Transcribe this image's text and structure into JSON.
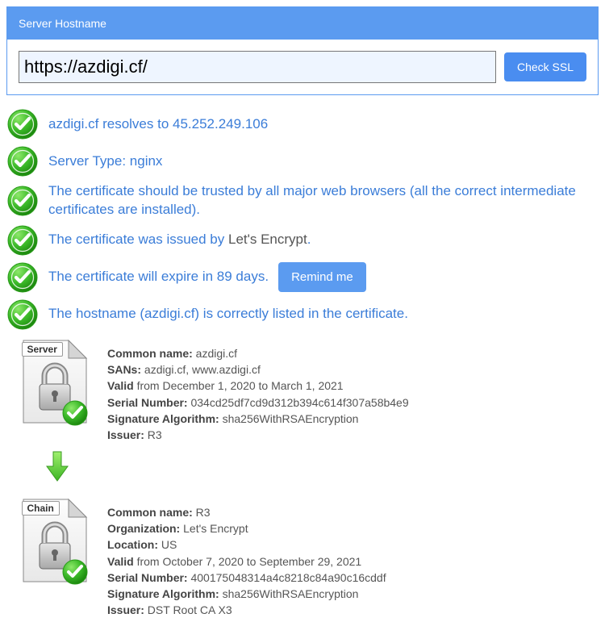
{
  "panel": {
    "title": "Server Hostname",
    "input_value": "https://azdigi.cf/",
    "check_button": "Check SSL"
  },
  "checks": {
    "resolves": "azdigi.cf resolves to 45.252.249.106",
    "server_type": "Server Type: nginx",
    "trusted": "The certificate should be trusted by all major web browsers (all the correct intermediate certificates are installed).",
    "issued_prefix": "The certificate was issued by ",
    "issued_by": "Let's Encrypt",
    "issued_suffix": ".",
    "expire": "The certificate will expire in 89 days.",
    "remind_button": "Remind me",
    "hostname_listed": "The hostname (azdigi.cf) is correctly listed in the certificate."
  },
  "server_cert": {
    "badge": "Server",
    "cn_label": "Common name:",
    "cn": " azdigi.cf",
    "sans_label": "SANs:",
    "sans": " azdigi.cf, www.azdigi.cf",
    "valid_label": "Valid",
    "valid": " from December 1, 2020 to March 1, 2021",
    "serial_label": "Serial Number:",
    "serial": " 034cd25df7cd9d312b394c614f307a58b4e9",
    "sigalg_label": "Signature Algorithm:",
    "sigalg": " sha256WithRSAEncryption",
    "issuer_label": "Issuer:",
    "issuer": " R3"
  },
  "chain_cert": {
    "badge": "Chain",
    "cn_label": "Common name:",
    "cn": " R3",
    "org_label": "Organization:",
    "org": " Let's Encrypt",
    "loc_label": "Location:",
    "loc": " US",
    "valid_label": "Valid",
    "valid": " from October 7, 2020 to September 29, 2021",
    "serial_label": "Serial Number:",
    "serial": " 400175048314a4c8218c84a90c16cddf",
    "sigalg_label": "Signature Algorithm:",
    "sigalg": " sha256WithRSAEncryption",
    "issuer_label": "Issuer:",
    "issuer": " DST Root CA X3"
  }
}
